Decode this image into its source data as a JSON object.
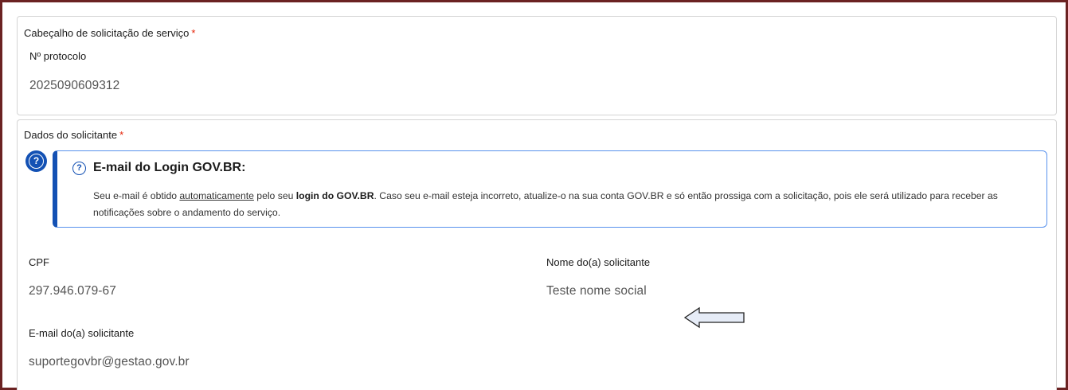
{
  "header_section": {
    "title": "Cabeçalho de solicitação de serviço",
    "required_mark": "*",
    "protocolo_label": "Nº protocolo",
    "protocolo_value": "2025090609312"
  },
  "dados_section": {
    "title": "Dados do solicitante",
    "required_mark": "*",
    "info": {
      "title": "E-mail do Login GOV.BR:",
      "text_1": "Seu e-mail é obtido ",
      "text_link": "automaticamente",
      "text_2": " pelo seu ",
      "text_bold": "login do GOV.BR",
      "text_3": ". Caso seu e-mail esteja incorreto, atualize-o na sua conta GOV.BR e só então prossiga com a solicitação, pois ele será utilizado para receber as notificações sobre o andamento do serviço."
    },
    "cpf_label": "CPF",
    "cpf_value": "297.946.079-67",
    "nome_label": "Nome do(a) solicitante",
    "nome_value": "Teste nome social",
    "email_label": "E-mail do(a) solicitante",
    "email_value": "suportegovbr@gestao.gov.br"
  },
  "icons": {
    "side": "help-circle-icon",
    "inline": "question-circle-icon",
    "arrow": "left-arrow-icon"
  },
  "colors": {
    "frame_border": "#6b2222",
    "accent_blue": "#1351b4",
    "required_red": "#e52207"
  }
}
